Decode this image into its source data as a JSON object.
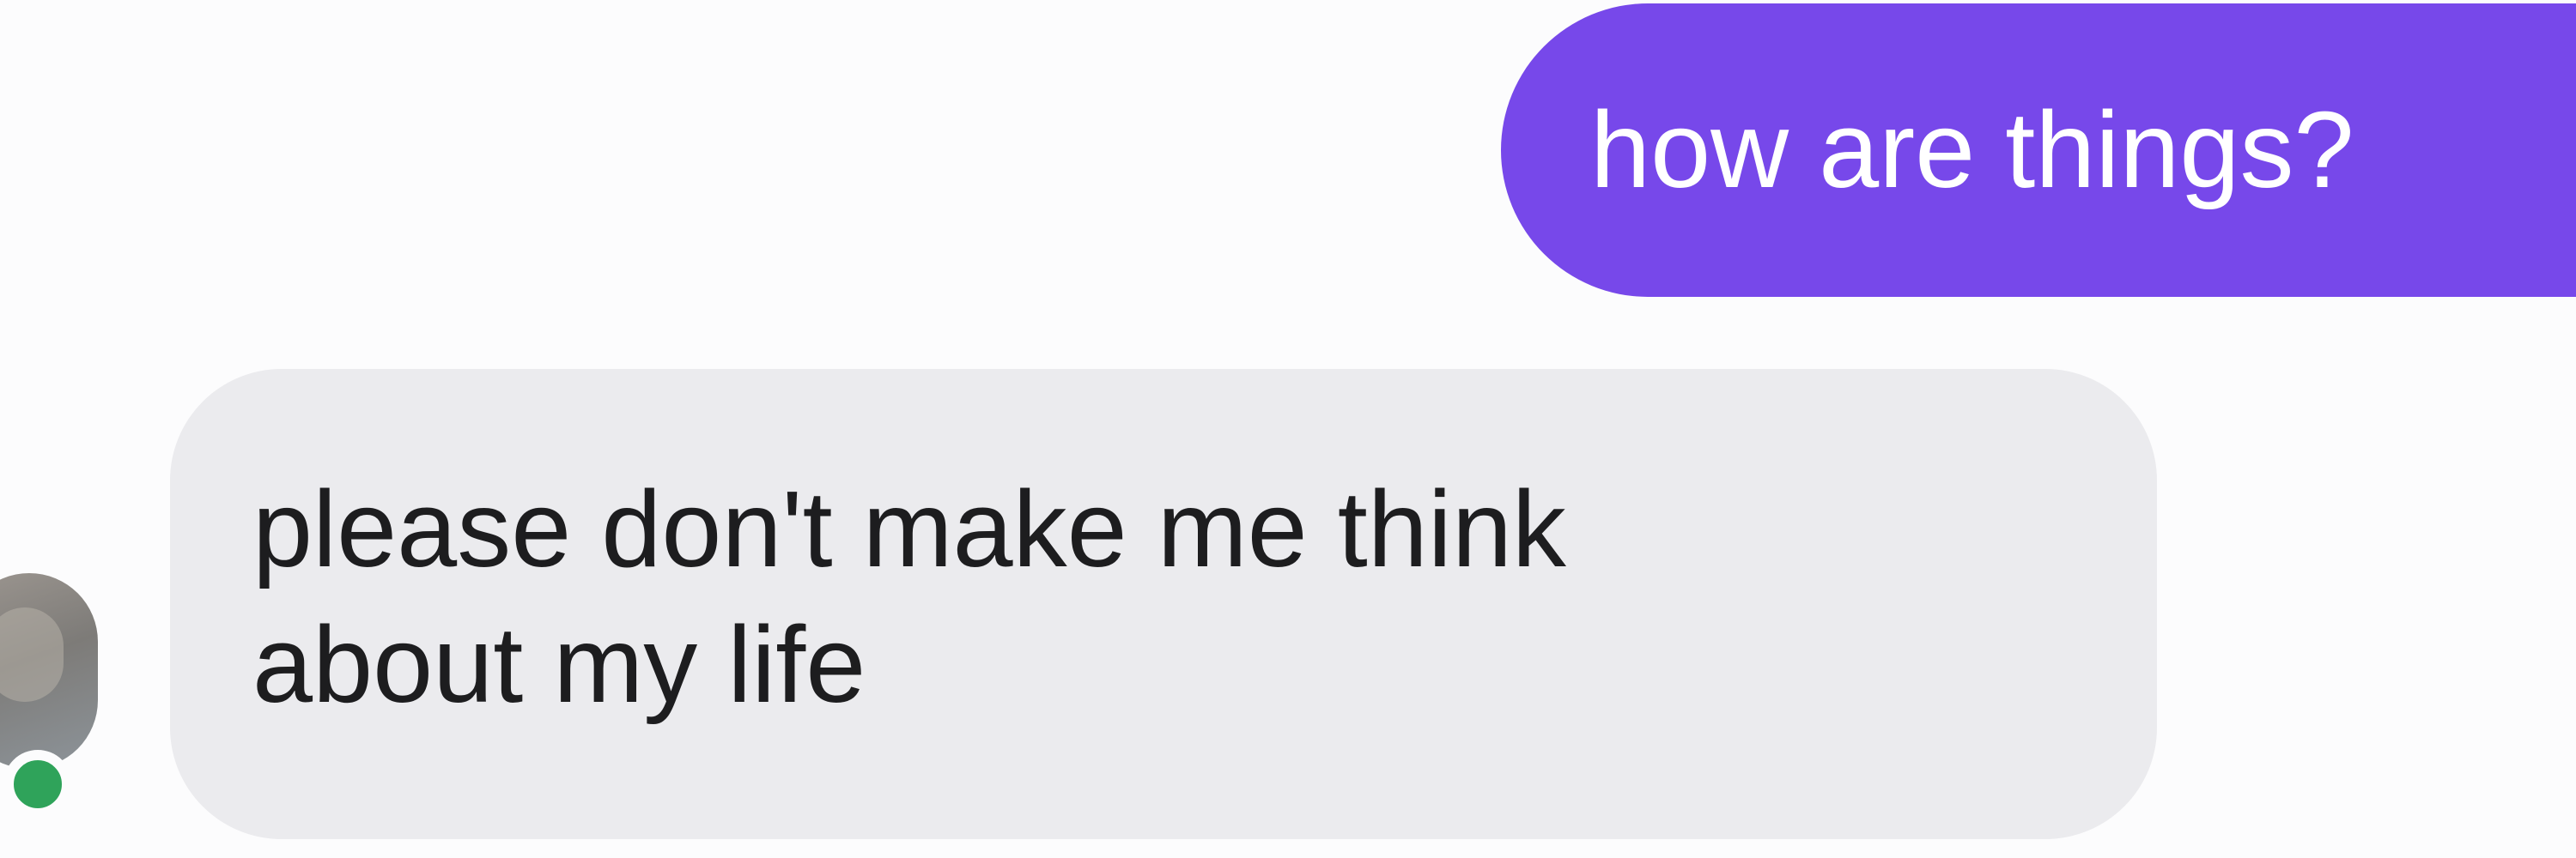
{
  "conversation": {
    "messages": [
      {
        "direction": "outgoing",
        "lines": [
          "how are things?"
        ],
        "bubble_color": "#7748ea"
      },
      {
        "direction": "incoming",
        "lines": [
          "please don't make me think",
          "about my life"
        ],
        "bubble_color": "#ebebee"
      }
    ],
    "contact": {
      "avatar_icon": "avatar-photo",
      "status": "online",
      "status_color": "#2fa35a"
    }
  }
}
